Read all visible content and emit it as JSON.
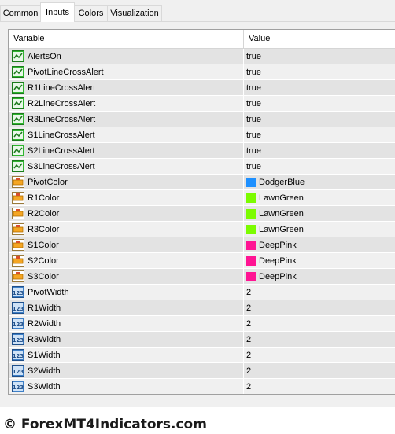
{
  "tabs": [
    {
      "label": "Common",
      "active": false
    },
    {
      "label": "Inputs",
      "active": true
    },
    {
      "label": "Colors",
      "active": false
    },
    {
      "label": "Visualization",
      "active": false
    }
  ],
  "table": {
    "headers": {
      "variable": "Variable",
      "value": "Value"
    },
    "rows": [
      {
        "variable": "AlertsOn",
        "value": "true",
        "icon": "bool-icon"
      },
      {
        "variable": "PivotLineCrossAlert",
        "value": "true",
        "icon": "bool-icon"
      },
      {
        "variable": "R1LineCrossAlert",
        "value": "true",
        "icon": "bool-icon"
      },
      {
        "variable": "R2LineCrossAlert",
        "value": "true",
        "icon": "bool-icon"
      },
      {
        "variable": "R3LineCrossAlert",
        "value": "true",
        "icon": "bool-icon"
      },
      {
        "variable": "S1LineCrossAlert",
        "value": "true",
        "icon": "bool-icon"
      },
      {
        "variable": "S2LineCrossAlert",
        "value": "true",
        "icon": "bool-icon"
      },
      {
        "variable": "S3LineCrossAlert",
        "value": "true",
        "icon": "bool-icon"
      },
      {
        "variable": "PivotColor",
        "value": "DodgerBlue",
        "icon": "color-icon",
        "swatch": "#1e90ff"
      },
      {
        "variable": "R1Color",
        "value": "LawnGreen",
        "icon": "color-icon",
        "swatch": "#7cfc00"
      },
      {
        "variable": "R2Color",
        "value": "LawnGreen",
        "icon": "color-icon",
        "swatch": "#7cfc00"
      },
      {
        "variable": "R3Color",
        "value": "LawnGreen",
        "icon": "color-icon",
        "swatch": "#7cfc00"
      },
      {
        "variable": "S1Color",
        "value": "DeepPink",
        "icon": "color-icon",
        "swatch": "#ff1493"
      },
      {
        "variable": "S2Color",
        "value": "DeepPink",
        "icon": "color-icon",
        "swatch": "#ff1493"
      },
      {
        "variable": "S3Color",
        "value": "DeepPink",
        "icon": "color-icon",
        "swatch": "#ff1493"
      },
      {
        "variable": "PivotWidth",
        "value": "2",
        "icon": "integer-icon"
      },
      {
        "variable": "R1Width",
        "value": "2",
        "icon": "integer-icon"
      },
      {
        "variable": "R2Width",
        "value": "2",
        "icon": "integer-icon"
      },
      {
        "variable": "R3Width",
        "value": "2",
        "icon": "integer-icon"
      },
      {
        "variable": "S1Width",
        "value": "2",
        "icon": "integer-icon"
      },
      {
        "variable": "S2Width",
        "value": "2",
        "icon": "integer-icon"
      },
      {
        "variable": "S3Width",
        "value": "2",
        "icon": "integer-icon"
      }
    ]
  },
  "watermark": "© ForexMT4Indicators.com"
}
